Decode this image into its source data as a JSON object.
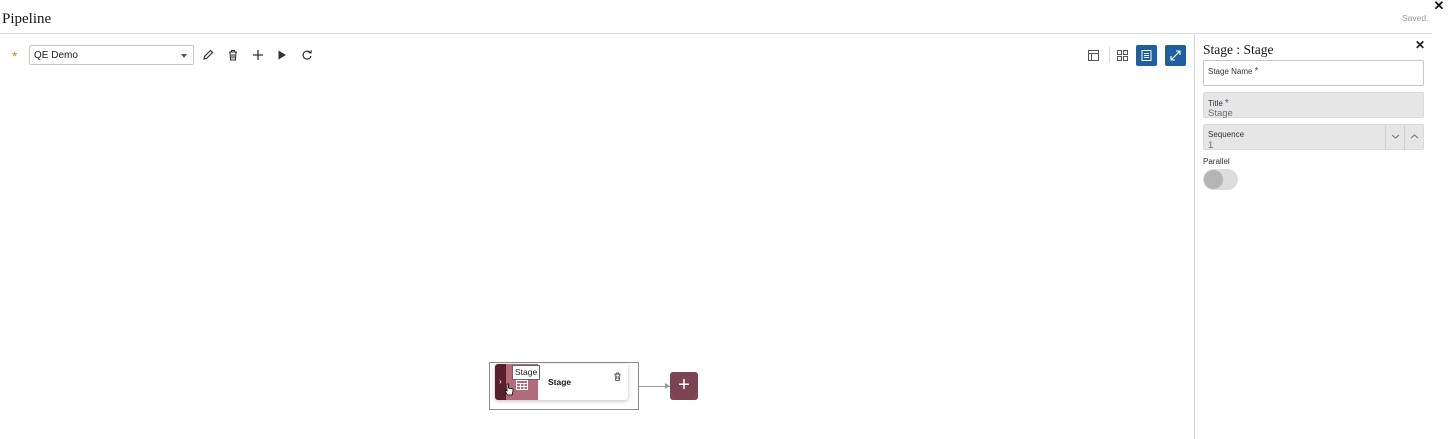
{
  "header": {
    "title": "Pipeline",
    "status": "Saved.",
    "close_icon": "close-icon"
  },
  "toolbar": {
    "required_marker": "*",
    "pipeline_select": {
      "value": "QE Demo"
    },
    "actions": [
      "pencil-icon",
      "trash-icon",
      "plus-icon",
      "play-icon",
      "refresh-icon"
    ],
    "views": [
      "layout-icon",
      "grid-icon",
      "list-icon",
      "expand-icon"
    ],
    "active_view": "list-icon"
  },
  "canvas": {
    "stage_node": {
      "tooltip": "Stage",
      "name": "Stage",
      "chevron": "›"
    },
    "add_button": "+"
  },
  "panel": {
    "title": "Stage : Stage",
    "close": "✕",
    "fields": {
      "stage_name": {
        "label": "Stage Name",
        "required": "*",
        "value": ""
      },
      "title": {
        "label": "Title",
        "required": "*",
        "value": "Stage"
      },
      "sequence": {
        "label": "Sequence",
        "value": "1"
      },
      "parallel": {
        "label": "Parallel",
        "on": false
      }
    }
  },
  "colors": {
    "accent": "#1e5fa0",
    "stage_dark": "#5a1f2c",
    "stage_mid": "#b06d79",
    "add_button": "#7c4453"
  }
}
